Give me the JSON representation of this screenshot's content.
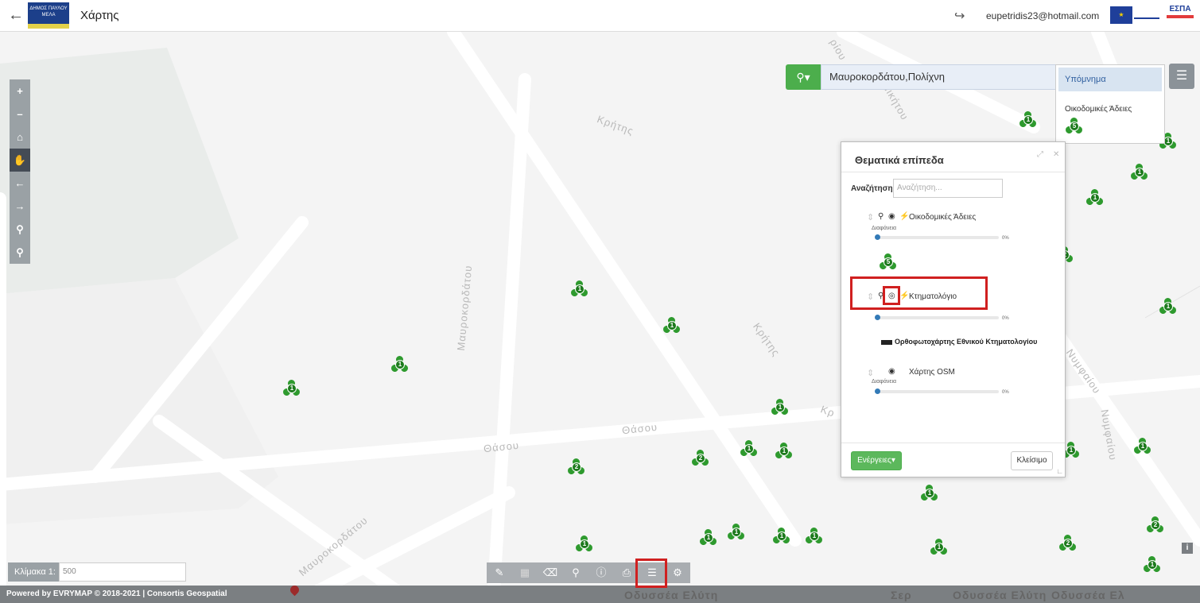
{
  "header": {
    "back_icon": "arrow-left-icon",
    "logo_text": "ΔΗΜΟΣ ΠΑΥΛΟΥ ΜΕΛΑ",
    "title": "Χάρτης",
    "logout_icon": "sign-out-icon",
    "user_email": "eupetridis23@hotmail.com",
    "espa_logo_text": "ΕΣΠΑ"
  },
  "map_toolbar": {
    "buttons": [
      "zoom-in",
      "zoom-out",
      "home",
      "pan",
      "previous-extent",
      "next-extent",
      "zoom-in-box",
      "zoom-out-box"
    ],
    "active": "pan"
  },
  "search": {
    "icon": "search-icon",
    "value": "Μαυροκορδάτου,Πολίχνη"
  },
  "legend": {
    "title": "Υπόμνημα",
    "item_label": "Οικοδομικές Άδειες",
    "item_marker_count": "5"
  },
  "streets": {
    "kritis_1": "Κρήτης",
    "kritis_2": "Κρήτης",
    "kritis_3": "Κρ",
    "mavrokordatou_1": "Μαυροκορδάτου",
    "mavrokordatou_2": "Μαυροκορδάτου",
    "thasou_1": "Θάσου",
    "thasou_2": "Θάσου",
    "nymfaiou_1": "Νυμφαίου",
    "nymfaiou_2": "Νυμφαίου",
    "top_1": "ρίου",
    "top_2": "Νικήτου"
  },
  "markers": [
    {
      "label": "1"
    },
    {
      "label": "1"
    },
    {
      "label": "1"
    },
    {
      "label": "1"
    },
    {
      "label": "1"
    },
    {
      "label": "1"
    },
    {
      "label": "1"
    },
    {
      "label": "1"
    },
    {
      "label": "1"
    },
    {
      "label": "2"
    },
    {
      "label": "2"
    },
    {
      "label": "1"
    },
    {
      "label": "1"
    },
    {
      "label": "1"
    },
    {
      "label": "1"
    },
    {
      "label": "2"
    },
    {
      "label": "1"
    },
    {
      "label": "1"
    },
    {
      "label": "1"
    },
    {
      "label": "1"
    },
    {
      "label": "2"
    },
    {
      "label": "1"
    },
    {
      "label": "1"
    },
    {
      "label": "2"
    },
    {
      "label": "1"
    },
    {
      "label": "1"
    },
    {
      "label": "1"
    }
  ],
  "layers_panel": {
    "title": "Θεματικά επίπεδα",
    "search_label": "Αναζήτηση",
    "search_placeholder": "Αναζήτηση...",
    "layers": [
      {
        "name": "Οικοδομικές Άδειες",
        "sub": "Διαφάνεια",
        "opacity": "0%",
        "marker_count": "5"
      },
      {
        "name": "Κτηματολόγιο",
        "sub": "",
        "opacity": "0%"
      },
      {
        "name": "Χάρτης OSM",
        "sub": "Διαφάνεια",
        "opacity": "0%"
      }
    ],
    "basemap_label": "Ορθοφωτοχάρτης Εθνικού Κτηματολογίου",
    "actions_label": "Ενέργειες",
    "close_label": "Κλείσιμο"
  },
  "scale": {
    "label": "Κλίμακα 1:",
    "value": "500"
  },
  "bottom_tools": [
    "ruler-icon",
    "area-measure-icon",
    "eraser-icon",
    "map-pin-icon",
    "info-icon",
    "print-icon",
    "layers-icon",
    "layer-settings-icon"
  ],
  "footer": {
    "text": "Powered by EVRYMAP © 2018-2021 | Consortis Geospatial",
    "street_1": "Οδυσσέα Ελύτη",
    "street_2": "Οδυσσέα Ελύτη",
    "street_3": "Οδυσσέα Ελ",
    "street_4": "Σερ"
  },
  "info_badge": "i"
}
